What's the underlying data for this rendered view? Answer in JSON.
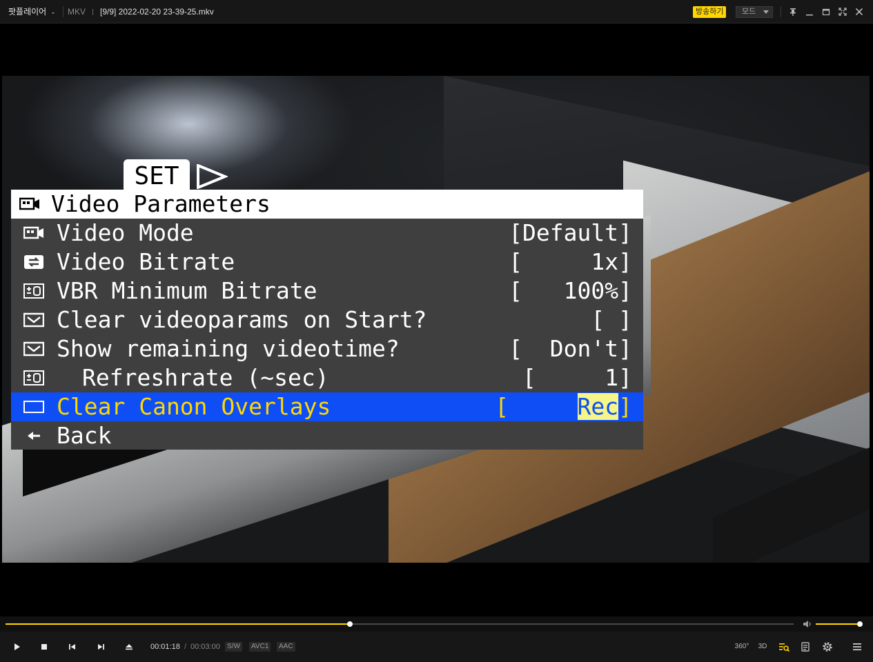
{
  "titlebar": {
    "app_name": "팟플레이어",
    "format": "MKV",
    "filename": "[9/9]  2022-02-20  23-39-25.mkv",
    "broadcast_label": "방송하기",
    "mode_label": "모드",
    "accent_color": "#ffd600"
  },
  "osd": {
    "tab_label": "SET",
    "header": "Video Parameters",
    "items": [
      {
        "label": "Video Mode",
        "value": "[Default]",
        "icon": "video-camera-icon"
      },
      {
        "label": "Video Bitrate",
        "value": "[     1x]",
        "icon": "arrows-cycle-icon"
      },
      {
        "label": "VBR Minimum Bitrate",
        "value": "[   100%]",
        "icon": "plus-minus-icon"
      },
      {
        "label": "Clear videoparams on Start?",
        "value": "[ ]",
        "icon": "checkbox-icon"
      },
      {
        "label": "Show remaining videotime?",
        "value": "[  Don't]",
        "icon": "checkbox-icon"
      },
      {
        "label": "Refreshrate (~sec)",
        "value": "[     1]",
        "icon": "plus-minus-icon"
      },
      {
        "label": "Clear Canon Overlays",
        "value_open": "[     ",
        "value_highlight": "Rec",
        "value_close": "]",
        "icon": "empty-box-icon",
        "selected": true
      },
      {
        "label": "Back",
        "icon": "back-arrow-icon"
      }
    ],
    "highlight_color": "#0f4ef5",
    "selected_text_color": "#ffd800"
  },
  "playback": {
    "current_time": "00:01:18",
    "separator": "/",
    "total_time": "00:03:00",
    "progress_fraction": 0.437,
    "volume_fraction": 1.0,
    "badges": [
      "S/W",
      "AVC1",
      "AAC"
    ],
    "right_buttons": {
      "vr": "360°",
      "three_d": "3D"
    }
  }
}
